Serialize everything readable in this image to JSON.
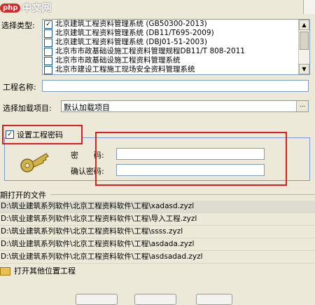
{
  "logo": {
    "badge": "php",
    "text": "中文网"
  },
  "project_type": {
    "label": "选择类型:",
    "items": [
      {
        "text": "北京建筑工程资料管理系统 (GB50300-2013)",
        "checked": true
      },
      {
        "text": "北京建筑工程资料管理系统 (DB11/T695-2009)",
        "checked": false
      },
      {
        "text": "北京建筑工程资料管理系统 (DBJ01-51-2003)",
        "checked": false
      },
      {
        "text": "北京市市政基础设施工程资料管理规程DB11/T 808-2011",
        "checked": false
      },
      {
        "text": "北京市市政基础设施工程资料管理系统",
        "checked": false
      },
      {
        "text": "北京市建设工程施工现场安全资料管理系统",
        "checked": false
      }
    ]
  },
  "project_name": {
    "label": "工程名称:",
    "value": ""
  },
  "load_item": {
    "label": "选择加载项目:",
    "value": "默认加载项目",
    "button": "..."
  },
  "password_section": {
    "checkbox_label": "设置工程密码",
    "checked": true,
    "password_label": "密　　码:",
    "confirm_label": "确认密码:",
    "password_value": "",
    "confirm_value": ""
  },
  "recent": {
    "label": "期打开的文件",
    "files": [
      "D:\\筑业建筑系列软件\\北京工程资料软件\\工程\\xadasd.zyzl",
      "D:\\筑业建筑系列软件\\北京工程资料软件\\工程\\导入工程.zyzl",
      "D:\\筑业建筑系列软件\\北京工程资料软件\\工程\\ssss.zyzl",
      "D:\\筑业建筑系列软件\\北京工程资料软件\\工程\\asdada.zyzl",
      "D:\\筑业建筑系列软件\\北京工程资料软件\\工程\\asdsadad.zyzl"
    ],
    "open_other": "打开其他位置工程"
  }
}
